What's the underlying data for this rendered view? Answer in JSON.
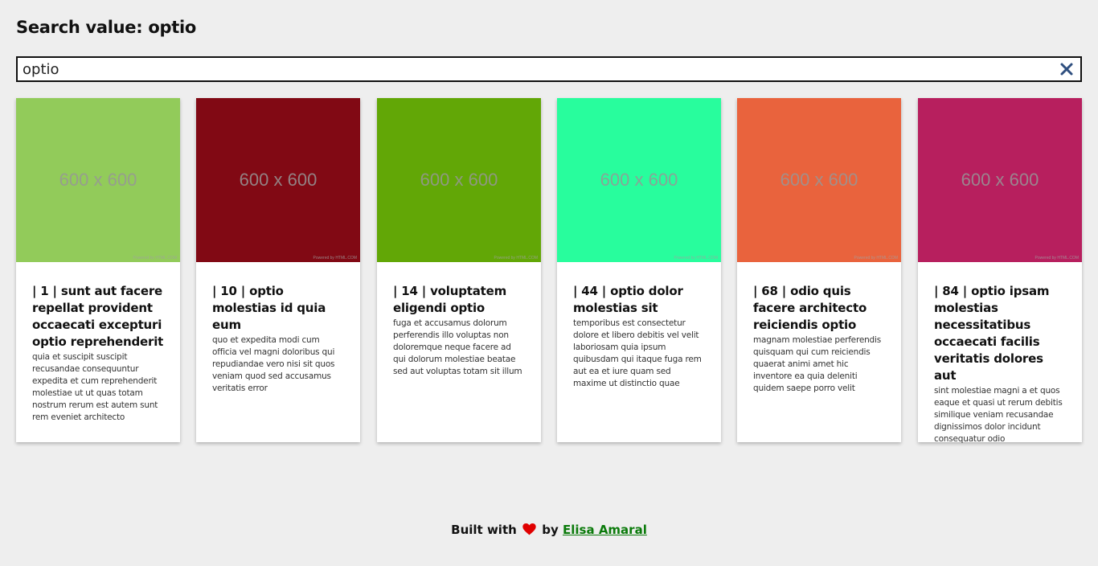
{
  "header": {
    "title": "Search value: optio"
  },
  "search": {
    "value": "optio",
    "clear_icon": "close-icon"
  },
  "cards": [
    {
      "color": "#92cb5a",
      "image_label": "600 x 600",
      "image_footer": "Powered by HTML.COM",
      "title": "| 1 | sunt aut facere repellat provident occaecati excepturi optio reprehenderit",
      "body": "quia et suscipit suscipit recusandae consequuntur expedita et cum reprehenderit molestiae ut ut quas totam nostrum rerum est autem sunt rem eveniet architecto"
    },
    {
      "color": "#810914",
      "image_label": "600 x 600",
      "image_footer": "Powered by HTML.COM",
      "title": "| 10 | optio molestias id quia eum",
      "body": "quo et expedita modi cum officia vel magni doloribus qui repudiandae vero nisi sit quos veniam quod sed accusamus veritatis error"
    },
    {
      "color": "#62a706",
      "image_label": "600 x 600",
      "image_footer": "Powered by HTML.COM",
      "title": "| 14 | voluptatem eligendi optio",
      "body": "fuga et accusamus dolorum perferendis illo voluptas non doloremque neque facere ad qui dolorum molestiae beatae sed aut voluptas totam sit illum"
    },
    {
      "color": "#28fd9d",
      "image_label": "600 x 600",
      "image_footer": "Powered by HTML.COM",
      "title": "| 44 | optio dolor molestias sit",
      "body": "temporibus est consectetur dolore et libero debitis vel velit laboriosam quia ipsum quibusdam qui itaque fuga rem aut ea et iure quam sed maxime ut distinctio quae"
    },
    {
      "color": "#e9633d",
      "image_label": "600 x 600",
      "image_footer": "Powered by HTML.COM",
      "title": "| 68 | odio quis facere architecto reiciendis optio",
      "body": "magnam molestiae perferendis quisquam qui cum reiciendis quaerat animi amet hic inventore ea quia deleniti quidem saepe porro velit"
    },
    {
      "color": "#b71f5e",
      "image_label": "600 x 600",
      "image_footer": "Powered by HTML.COM",
      "title": "| 84 | optio ipsam molestias necessitatibus occaecati facilis veritatis dolores aut",
      "body": "sint molestiae magni a et quos eaque et quasi ut rerum debitis similique veniam recusandae dignissimos dolor incidunt consequatur odio"
    }
  ],
  "footer": {
    "prefix": "Built with",
    "icon": "heart-icon",
    "heart_color": "#e00000",
    "middle": "by",
    "author": "Elisa Amaral",
    "link_color": "#0a7a0a"
  }
}
